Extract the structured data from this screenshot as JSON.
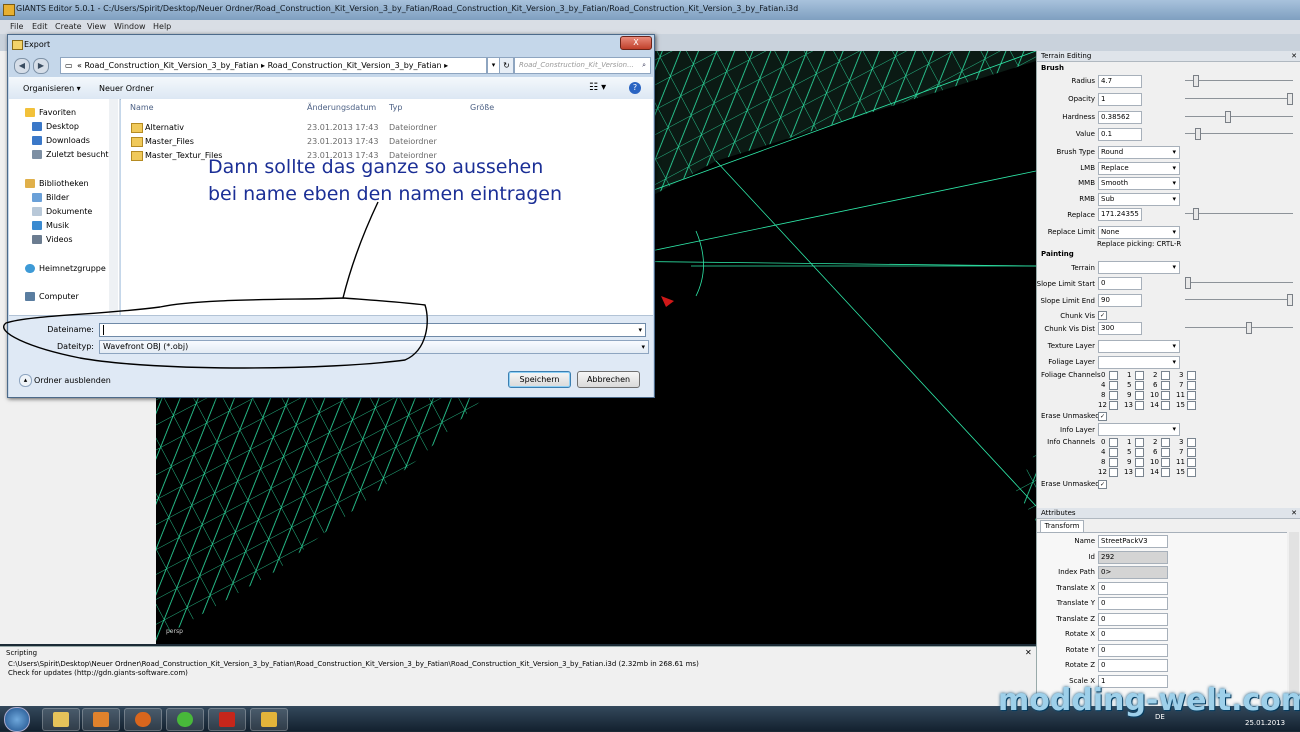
{
  "app": {
    "title": "GIANTS Editor 5.0.1 - C:/Users/Spirit/Desktop/Neuer Ordner/Road_Construction_Kit_Version_3_by_Fatian/Road_Construction_Kit_Version_3_by_Fatian/Road_Construction_Kit_Version_3_by_Fatian.i3d",
    "menu": [
      "File",
      "Edit",
      "Create",
      "View",
      "Window",
      "Help"
    ]
  },
  "viewport": {
    "label": "persp"
  },
  "terrain": {
    "title": "Terrain Editing",
    "brush_section": "Brush",
    "radius_label": "Radius",
    "radius": "4.7",
    "opacity_label": "Opacity",
    "opacity": "1",
    "hardness_label": "Hardness",
    "hardness": "0.38562",
    "value_label": "Value",
    "value": "0.1",
    "brushtype_label": "Brush Type",
    "brushtype": "Round",
    "lmb_label": "LMB",
    "lmb": "Replace",
    "mmb_label": "MMB",
    "mmb": "Smooth",
    "rmb_label": "RMB",
    "rmb": "Sub",
    "replace_label": "Replace",
    "replace": "171.24355",
    "replacelimit_label": "Replace Limit",
    "replacelimit": "None",
    "replace_picking": "Replace picking: CRTL-R",
    "painting_section": "Painting",
    "terrain_label": "Terrain",
    "slope_start_label": "Slope Limit Start",
    "slope_start": "0",
    "slope_end_label": "Slope Limit End",
    "slope_end": "90",
    "chunk_vis_label": "Chunk Vis",
    "chunk_vis_checked": "✓",
    "chunk_dist_label": "Chunk Vis Dist",
    "chunk_dist": "300",
    "texture_layer_label": "Texture Layer",
    "foliage_layer_label": "Foliage Layer",
    "foliage_channels_label": "Foliage Channels",
    "erase_unmasked_label": "Erase Unmasked",
    "info_layer_label": "Info Layer",
    "info_channels_label": "Info Channels",
    "erase_unmasked2_label": "Erase Unmasked",
    "channels": [
      "0",
      "1",
      "2",
      "3",
      "4",
      "5",
      "6",
      "7",
      "8",
      "9",
      "10",
      "11",
      "12",
      "13",
      "14",
      "15"
    ],
    "slider_levels": {
      "radius": 0.08,
      "opacity": 1.0,
      "hardness": 0.39,
      "value": 0.1,
      "replace": 0.08,
      "slope_start": 0.0,
      "slope_end": 1.0,
      "chunk_dist": 0.6
    }
  },
  "attributes": {
    "title": "Attributes",
    "tab": "Transform",
    "rows": [
      {
        "label": "Name",
        "value": "StreetPackV3"
      },
      {
        "label": "Id",
        "value": "292"
      },
      {
        "label": "Index Path",
        "value": "0>"
      },
      {
        "label": "Translate X",
        "value": "0"
      },
      {
        "label": "Translate Y",
        "value": "0"
      },
      {
        "label": "Translate Z",
        "value": "0"
      },
      {
        "label": "Rotate X",
        "value": "0"
      },
      {
        "label": "Rotate Y",
        "value": "0"
      },
      {
        "label": "Rotate Z",
        "value": "0"
      },
      {
        "label": "Scale X",
        "value": "1"
      }
    ]
  },
  "scripting": {
    "title": "Scripting",
    "lines": [
      "C:\\Users\\Spirit\\Desktop\\Neuer Ordner\\Road_Construction_Kit_Version_3_by_Fatian\\Road_Construction_Kit_Version_3_by_Fatian\\Road_Construction_Kit_Version_3_by_Fatian.i3d (2.32mb in 268.61 ms)",
      "Check for updates (http://gdn.giants-software.com)"
    ]
  },
  "dialog": {
    "title": "Export",
    "close": "X",
    "address": "«  Road_Construction_Kit_Version_3_by_Fatian  ▸  Road_Construction_Kit_Version_3_by_Fatian  ▸",
    "search_placeholder": "Road_Construction_Kit_Version...",
    "toolbar": {
      "organize": "Organisieren ▾",
      "new_folder": "Neuer Ordner"
    },
    "nav": {
      "favorites": "Favoriten",
      "desktop": "Desktop",
      "downloads": "Downloads",
      "recent": "Zuletzt besucht",
      "libraries": "Bibliotheken",
      "pictures": "Bilder",
      "documents": "Dokumente",
      "music": "Musik",
      "videos": "Videos",
      "homegroup": "Heimnetzgruppe",
      "computer": "Computer"
    },
    "columns": {
      "name": "Name",
      "date": "Änderungsdatum",
      "type": "Typ",
      "size": "Größe"
    },
    "files": [
      {
        "name": "Alternativ",
        "date": "23.01.2013 17:43",
        "type": "Dateiordner"
      },
      {
        "name": "Master_Files",
        "date": "23.01.2013 17:43",
        "type": "Dateiordner"
      },
      {
        "name": "Master_Textur_Files",
        "date": "23.01.2013 17:43",
        "type": "Dateiordner"
      }
    ],
    "filename_label": "Dateiname:",
    "filename_value": "",
    "filetype_label": "Dateityp:",
    "filetype_value": "Wavefront OBJ (*.obj)",
    "hide_folders": "Ordner ausblenden",
    "save": "Speichern",
    "cancel": "Abbrechen"
  },
  "annotation": {
    "line1": "Dann sollte das ganze so aussehen",
    "line2": "bei name eben den namen eintragen"
  },
  "taskbar": {
    "lang": "DE",
    "date": "25.01.2013"
  },
  "watermark": "modding-welt.com",
  "colors": {
    "wire": "#2ee8a8",
    "annotation": "#1b2f96",
    "accent": "#3d7bd9"
  }
}
